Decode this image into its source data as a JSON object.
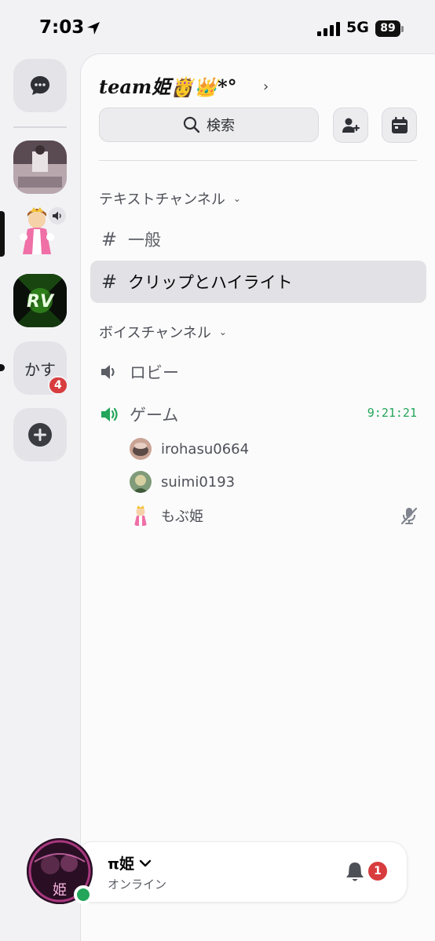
{
  "status_bar": {
    "time": "7:03",
    "network": "5G",
    "battery": "89",
    "icons": [
      "location-arrow-icon",
      "signal-icon",
      "battery-icon"
    ]
  },
  "rail": {
    "dm_icon": "chat-bubble-icon",
    "servers": [
      {
        "kind": "image",
        "icon": "server-photo"
      },
      {
        "kind": "image",
        "icon": "server-princess-illustration",
        "voice_active": true,
        "selected": true
      },
      {
        "kind": "image",
        "icon": "server-rv-logo",
        "logo_text": "RV"
      },
      {
        "kind": "text",
        "label": "かす",
        "badge": "4",
        "unread": true
      }
    ],
    "add_icon": "plus-icon"
  },
  "header": {
    "server_name": "team姫👸👑*°",
    "search_label": "検索",
    "invite_icon": "add-member-icon",
    "events_icon": "calendar-icon"
  },
  "text_category": {
    "label": "テキストチャンネル",
    "channels": [
      {
        "name": "一般",
        "selected": false
      },
      {
        "name": "クリップとハイライト",
        "selected": true
      }
    ]
  },
  "voice_category": {
    "label": "ボイスチャンネル",
    "channels": [
      {
        "name": "ロビー",
        "active": false
      },
      {
        "name": "ゲーム",
        "active": true,
        "timer": "9:21:21"
      }
    ],
    "users": [
      {
        "name": "irohasu0664"
      },
      {
        "name": "suimi0193"
      },
      {
        "name": "もぶ姫",
        "muted": true
      }
    ]
  },
  "user_panel": {
    "name": "π姫",
    "status": "オンライン",
    "avatar_text": "姫",
    "notification_count": "1"
  },
  "colors": {
    "accent_green": "#23a55a",
    "badge_red": "#d83c3e",
    "selected_bg": "#e2e2e6"
  }
}
